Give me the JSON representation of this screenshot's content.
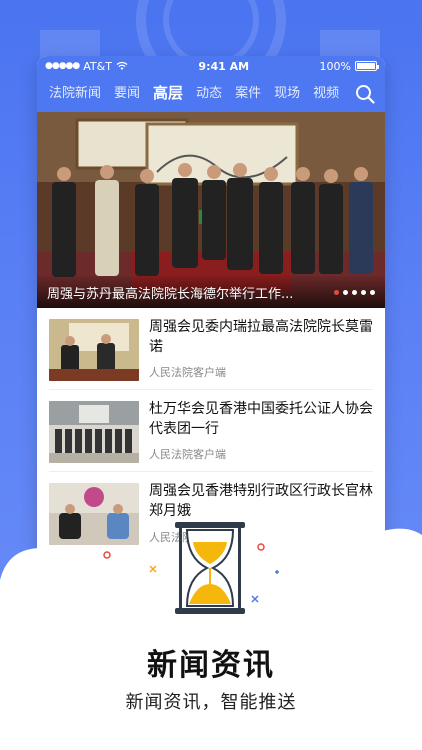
{
  "status": {
    "carrier": "AT&T",
    "time": "9:41 AM",
    "battery": "100%"
  },
  "tabs": [
    {
      "label": "法院新闻"
    },
    {
      "label": "要闻"
    },
    {
      "label": "高层",
      "active": true
    },
    {
      "label": "动态"
    },
    {
      "label": "案件"
    },
    {
      "label": "现场"
    },
    {
      "label": "视频"
    }
  ],
  "hero": {
    "caption": "周强与苏丹最高法院院长海德尔举行工作..."
  },
  "news": [
    {
      "title": "周强会见委内瑞拉最高法院院长莫雷诺",
      "source": "人民法院客户端"
    },
    {
      "title": "杜万华会见香港中国委托公证人协会代表团一行",
      "source": "人民法院客户端"
    },
    {
      "title": "周强会见香港特别行政区行政长官林郑月娥",
      "source": "人民法院客户端"
    }
  ],
  "footer": {
    "title": "新闻资讯",
    "subtitle": "新闻资讯，智能推送"
  },
  "colors": {
    "brand": "#4d78f2",
    "accent": "#e74b3c",
    "hourglass_sand": "#f5b70b"
  },
  "icons": {
    "search": "search-icon",
    "wifi": "wifi-icon",
    "battery": "battery-icon",
    "hourglass": "hourglass-icon"
  }
}
